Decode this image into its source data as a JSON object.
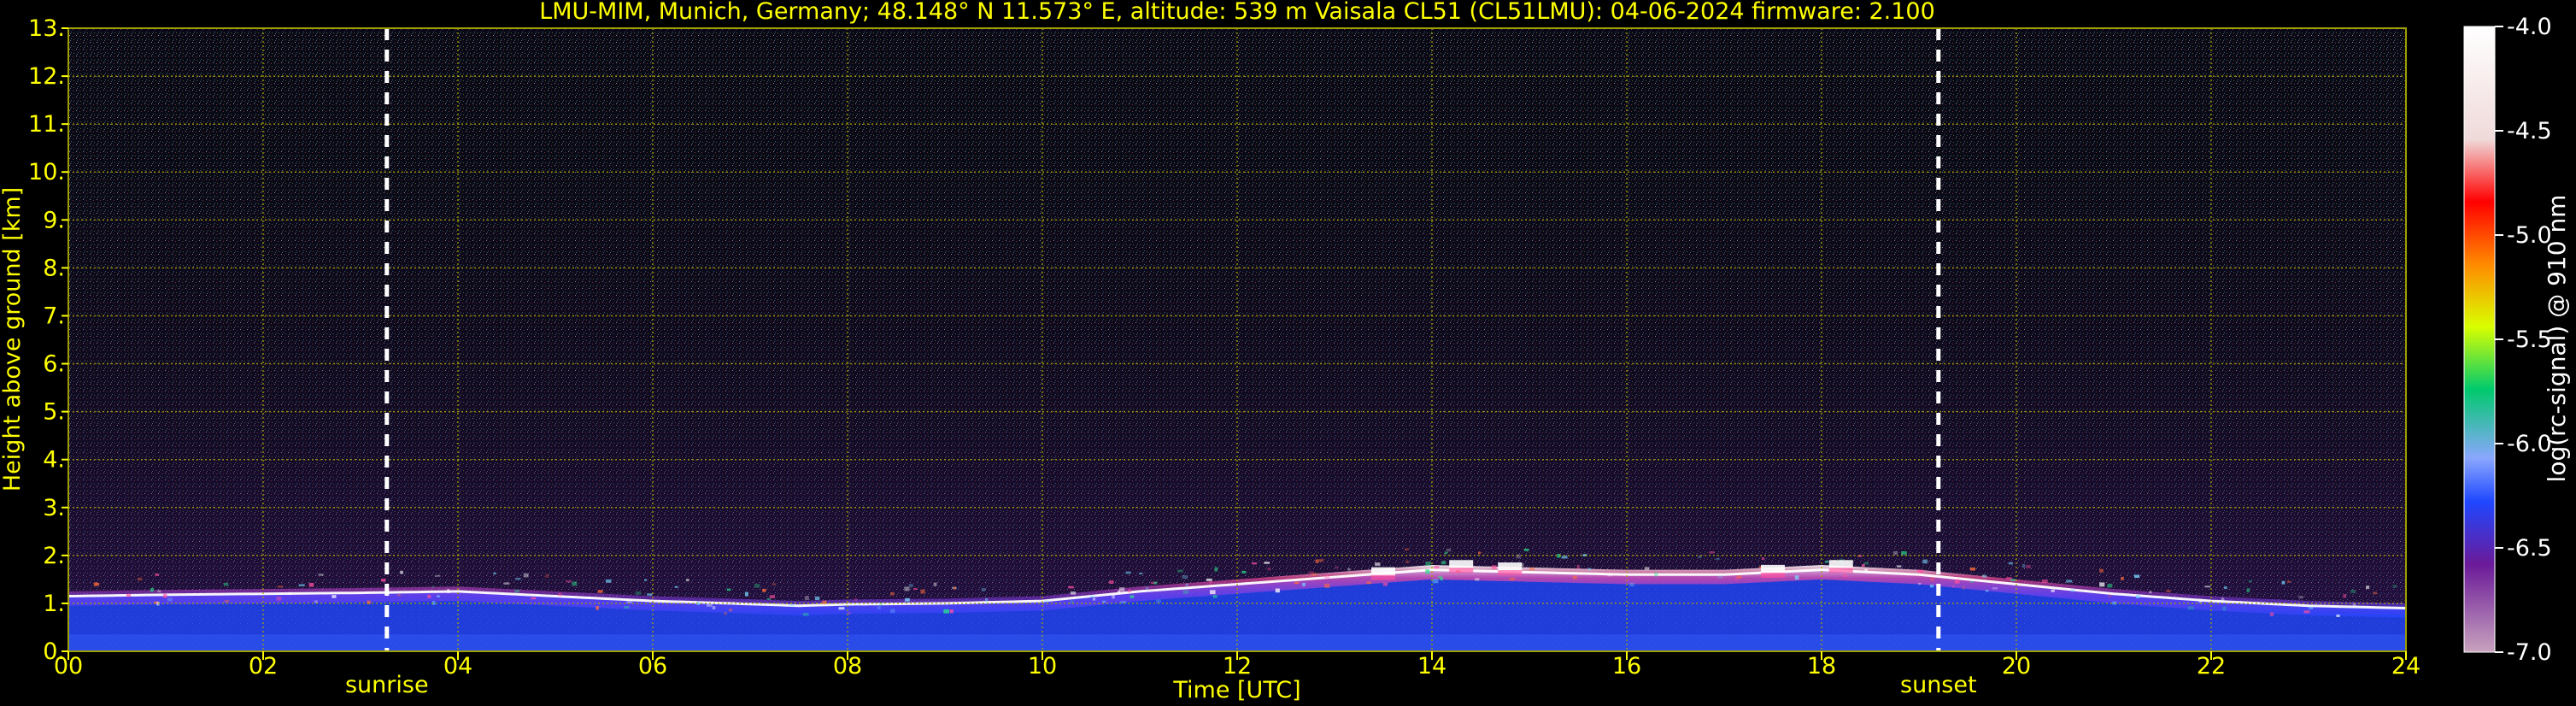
{
  "chart_data": {
    "type": "heatmap",
    "title": "LMU-MIM, Munich, Germany; 48.148° N 11.573° E, altitude: 539 m    Vaisala CL51 (CL51LMU): 04-06-2024    firmware: 2.100",
    "xlabel": "Time [UTC]",
    "ylabel": "Height above ground [km]",
    "xlim": [
      0,
      24
    ],
    "ylim": [
      0,
      13
    ],
    "grid": true,
    "x_ticks": [
      "00",
      "02",
      "04",
      "06",
      "08",
      "10",
      "12",
      "14",
      "16",
      "18",
      "20",
      "22",
      "24"
    ],
    "y_ticks": [
      "0.",
      "1.",
      "2.",
      "3.",
      "4.",
      "5.",
      "6.",
      "7.",
      "8.",
      "9.",
      "10.",
      "11.",
      "12.",
      "13."
    ],
    "annotations": [
      {
        "label": "sunrise",
        "x": 3.27
      },
      {
        "label": "sunset",
        "x": 19.2
      }
    ],
    "colorbar": {
      "label": "log(rc-signal) @ 910 nm",
      "ticks": [
        "-4.0",
        "-4.5",
        "-5.0",
        "-5.5",
        "-6.0",
        "-6.5",
        "-7.0"
      ],
      "range": [
        -7.0,
        -4.0
      ]
    },
    "aerosol_layer_top_km": {
      "x": [
        0,
        1,
        2,
        3,
        4,
        5,
        6,
        6.8,
        7.5,
        8,
        9,
        10,
        10.5,
        11,
        12,
        13,
        14,
        15,
        16,
        17,
        18,
        19,
        20,
        21,
        22,
        23,
        24
      ],
      "y": [
        1.15,
        1.18,
        1.2,
        1.22,
        1.25,
        1.15,
        1.05,
        1.0,
        0.95,
        0.98,
        1.0,
        1.05,
        1.15,
        1.25,
        1.4,
        1.55,
        1.7,
        1.65,
        1.6,
        1.6,
        1.7,
        1.6,
        1.4,
        1.2,
        1.05,
        0.95,
        0.9
      ]
    },
    "cloud_tops_km": {
      "x": [
        13.5,
        14.3,
        14.8,
        17.5,
        18.2
      ],
      "y": [
        1.7,
        1.85,
        1.8,
        1.75,
        1.85
      ]
    }
  }
}
